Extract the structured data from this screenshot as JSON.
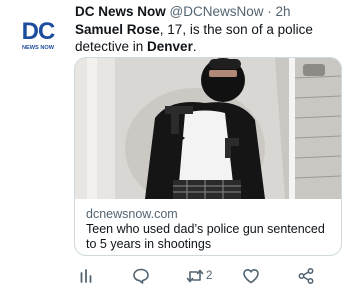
{
  "tweet": {
    "account": {
      "avatar_logo_text": "DC",
      "avatar_logo_subtext": "NEWS NOW",
      "display_name": "DC News Now",
      "handle": "@DCNewsNow",
      "separator": "·",
      "timestamp": "2h"
    },
    "text": {
      "name": "Samuel Rose",
      "middle": ", 17, is the son of a police detective in ",
      "city": "Denver",
      "end": "."
    },
    "card": {
      "domain": "dcnewsnow.com",
      "title": "Teen who used dad’s police gun sentenced to 5 years in shootings"
    },
    "actions": {
      "analytics_icon": "bar-chart-icon",
      "reply_icon": "speech-bubble-icon",
      "retweet_icon": "retweet-arrows-icon",
      "retweet_count": "2",
      "like_icon": "heart-icon",
      "share_icon": "share-nodes-icon"
    }
  },
  "colors": {
    "brand_blue": "#1d4e9e",
    "text_primary": "#0f1419",
    "text_secondary": "#536471",
    "border": "#cfd9de"
  }
}
